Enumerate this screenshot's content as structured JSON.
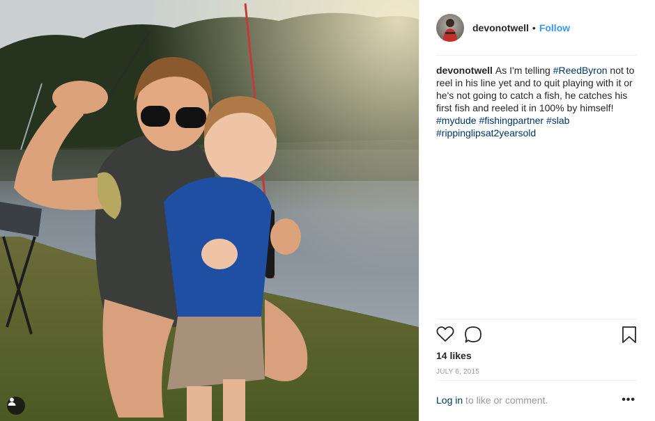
{
  "post": {
    "username": "devonotwell",
    "separator": "•",
    "follow_label": "Follow",
    "caption": {
      "username": "devonotwell",
      "segments": [
        {
          "type": "text",
          "value": "As I'm telling "
        },
        {
          "type": "hashtag",
          "value": "#ReedByron"
        },
        {
          "type": "text",
          "value": " not to reel in his line yet and to quit playing with it or he's not going to catch a fish, he catches his first fish and reeled it in 100% by himself! "
        },
        {
          "type": "hashtag",
          "value": "#mydude"
        },
        {
          "type": "text",
          "value": " "
        },
        {
          "type": "hashtag",
          "value": "#fishingpartner"
        },
        {
          "type": "text",
          "value": " "
        },
        {
          "type": "hashtag",
          "value": "#slab"
        },
        {
          "type": "text",
          "value": " "
        },
        {
          "type": "hashtag",
          "value": "#rippinglipsat2yearsold"
        }
      ]
    },
    "likes": "14 likes",
    "date": "JULY 6, 2015",
    "footer": {
      "login_label": "Log in",
      "rest": " to like or comment.",
      "more_label": "•••"
    }
  },
  "icons": {
    "like": "heart-icon",
    "comment": "comment-icon",
    "save": "bookmark-icon",
    "tagged": "user-tag-icon"
  },
  "colors": {
    "link_blue": "#3897f0",
    "hashtag_blue": "#003569",
    "muted_gray": "#999999",
    "text": "#262626"
  }
}
